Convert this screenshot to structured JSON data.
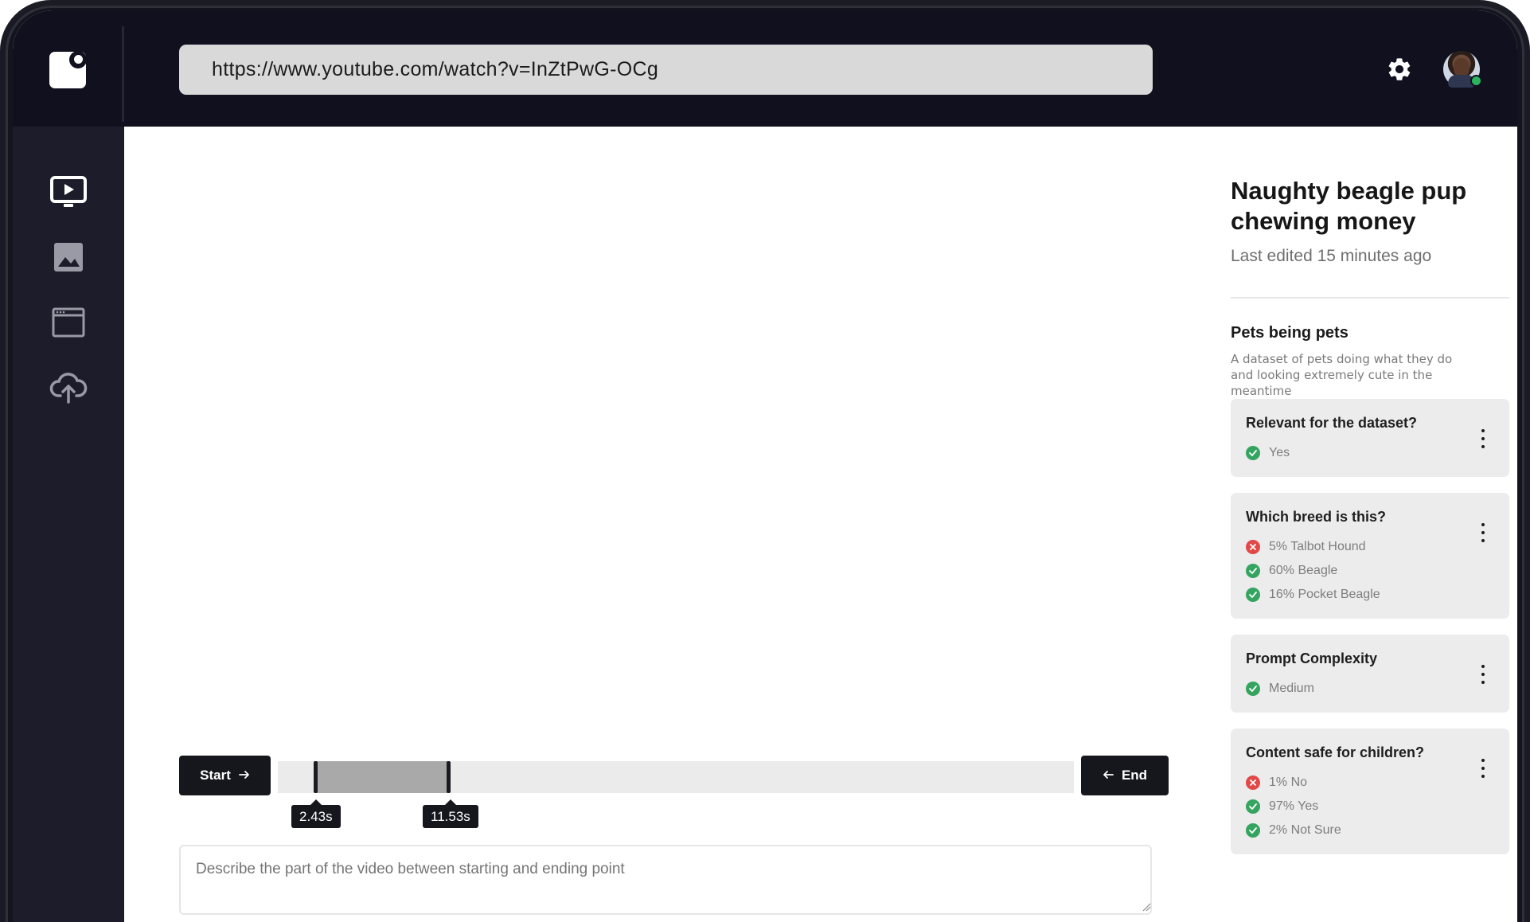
{
  "browser": {
    "url": "https://www.youtube.com/watch?v=InZtPwG-OCg"
  },
  "sidebar": {
    "items": [
      {
        "name": "video",
        "icon": "video-icon"
      },
      {
        "name": "image",
        "icon": "image-icon"
      },
      {
        "name": "browser",
        "icon": "browser-window-icon"
      },
      {
        "name": "upload",
        "icon": "cloud-upload-icon"
      }
    ]
  },
  "timeline": {
    "start_label": "Start",
    "end_label": "End",
    "start_time": "2.43s",
    "end_time": "11.53s",
    "description_placeholder": "Describe the part of the video between starting and ending point"
  },
  "panel": {
    "title": "Naughty beagle pup chewing money",
    "last_edited": "Last edited 15 minutes ago",
    "dataset_name": "Pets being pets",
    "dataset_description": "A dataset of pets doing what they do and looking extremely cute in the meantime",
    "cards": [
      {
        "question": "Relevant for the dataset?",
        "answers": [
          {
            "text": "Yes",
            "status": "ok"
          }
        ]
      },
      {
        "question": "Which breed is this?",
        "answers": [
          {
            "text": "5% Talbot Hound",
            "status": "no"
          },
          {
            "text": "60% Beagle",
            "status": "ok"
          },
          {
            "text": "16% Pocket Beagle",
            "status": "ok"
          }
        ]
      },
      {
        "question": "Prompt Complexity",
        "answers": [
          {
            "text": "Medium",
            "status": "ok"
          }
        ]
      },
      {
        "question": "Content safe for children?",
        "answers": [
          {
            "text": "1% No",
            "status": "no"
          },
          {
            "text": "97% Yes",
            "status": "ok"
          },
          {
            "text": "2% Not Sure",
            "status": "ok"
          }
        ]
      }
    ]
  },
  "colors": {
    "topbar": "#10101f",
    "sidebar": "#1c1c2a",
    "ok": "#34a460",
    "no": "#e24848",
    "accent_dark": "#16161d"
  }
}
